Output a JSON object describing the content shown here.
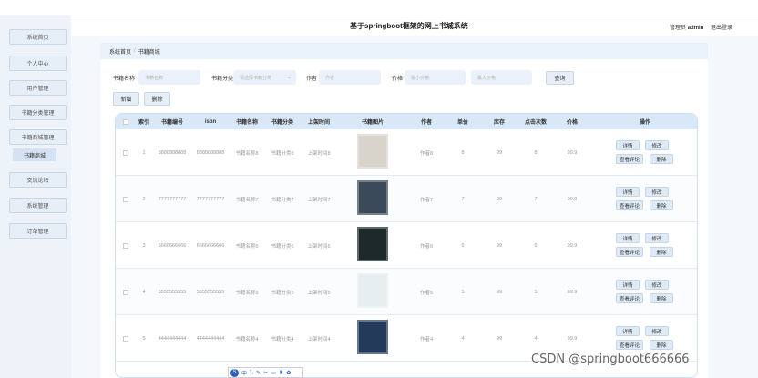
{
  "header": {
    "title": "基于springboot框架的网上书城系统",
    "user_label": "管理员",
    "user_name": "admin",
    "logout": "退出登录"
  },
  "sidebar": {
    "items": [
      "系统首页",
      "个人中心",
      "用户管理",
      "书籍分类管理",
      "书籍商城管理",
      "交流论坛",
      "系统管理",
      "订单管理"
    ],
    "sub_item": "书籍商城"
  },
  "breadcrumb": {
    "home": "系统首页",
    "separator": "/",
    "current": "书籍商城"
  },
  "filters": {
    "name_label": "书籍名称",
    "name_placeholder": "书籍名称",
    "category_label": "书籍分类",
    "category_placeholder": "请选择书籍分类",
    "author_label": "作者",
    "author_placeholder": "作者",
    "price_label": "价格",
    "price_min_placeholder": "最小价格",
    "price_max_placeholder": "最大价格",
    "search_button": "查询"
  },
  "actions": {
    "add": "新增",
    "delete": "删除"
  },
  "table": {
    "columns": [
      "索引",
      "书籍编号",
      "isbn",
      "书籍名称",
      "书籍分类",
      "上架时间",
      "书籍图片",
      "作者",
      "单价",
      "库存",
      "点击次数",
      "价格",
      "操作"
    ],
    "row_buttons": {
      "detail": "详情",
      "edit": "修改",
      "reviews": "查看评论",
      "delete": "删除"
    },
    "rows": [
      {
        "index": "1",
        "no": "8888888888",
        "isbn": "8888888888",
        "name": "书籍名称8",
        "category": "书籍分类8",
        "time": "上架时间8",
        "author": "作者8",
        "unit": "8",
        "stock": "99",
        "clicks": "8",
        "price": "99.9"
      },
      {
        "index": "2",
        "no": "7777777777",
        "isbn": "7777777777",
        "name": "书籍名称7",
        "category": "书籍分类7",
        "time": "上架时间7",
        "author": "作者7",
        "unit": "7",
        "stock": "99",
        "clicks": "7",
        "price": "99.9"
      },
      {
        "index": "3",
        "no": "6666666666",
        "isbn": "6666666666",
        "name": "书籍名称6",
        "category": "书籍分类6",
        "time": "上架时间6",
        "author": "作者6",
        "unit": "6",
        "stock": "99",
        "clicks": "6",
        "price": "99.9"
      },
      {
        "index": "4",
        "no": "5555555555",
        "isbn": "5555555555",
        "name": "书籍名称5",
        "category": "书籍分类5",
        "time": "上架时间5",
        "author": "作者5",
        "unit": "5",
        "stock": "99",
        "clicks": "5",
        "price": "99.9"
      },
      {
        "index": "5",
        "no": "4444444444",
        "isbn": "4444444444",
        "name": "书籍名称4",
        "category": "书籍分类4",
        "time": "上架时间4",
        "author": "作者4",
        "unit": "4",
        "stock": "99",
        "clicks": "4",
        "price": "99.9"
      }
    ]
  },
  "floating_toolbar": {
    "badge": "S",
    "items": [
      "中",
      "°,",
      "✎",
      "✂",
      "▭",
      "♜",
      "✿"
    ]
  },
  "watermark": "CSDN @springboot666666"
}
